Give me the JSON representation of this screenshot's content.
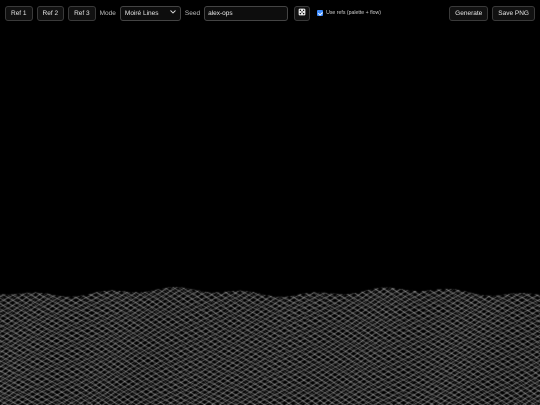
{
  "toolbar": {
    "ref_buttons": [
      "Ref 1",
      "Ref 2",
      "Ref 3"
    ],
    "mode_label": "Mode",
    "mode_value": "Moiré Lines",
    "seed_label": "Seed",
    "seed_value": "alex-ops",
    "randomize_icon": "dice-icon",
    "use_refs_checked": true,
    "use_refs_label": "Use refs (palette + flow)",
    "generate_label": "Generate",
    "save_label": "Save PNG"
  },
  "colors": {
    "background": "#000000",
    "accent": "#3b8bff",
    "line": "#ffffff"
  }
}
